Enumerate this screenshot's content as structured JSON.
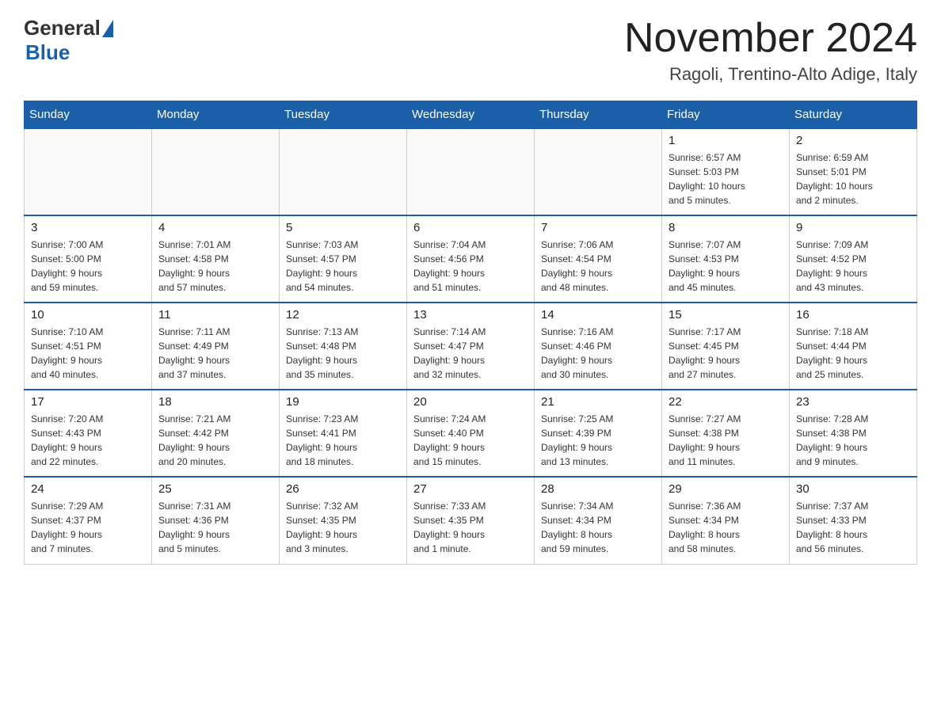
{
  "logo": {
    "general": "General",
    "blue": "Blue"
  },
  "title": "November 2024",
  "location": "Ragoli, Trentino-Alto Adige, Italy",
  "days_of_week": [
    "Sunday",
    "Monday",
    "Tuesday",
    "Wednesday",
    "Thursday",
    "Friday",
    "Saturday"
  ],
  "weeks": [
    [
      {
        "day": "",
        "info": ""
      },
      {
        "day": "",
        "info": ""
      },
      {
        "day": "",
        "info": ""
      },
      {
        "day": "",
        "info": ""
      },
      {
        "day": "",
        "info": ""
      },
      {
        "day": "1",
        "info": "Sunrise: 6:57 AM\nSunset: 5:03 PM\nDaylight: 10 hours\nand 5 minutes."
      },
      {
        "day": "2",
        "info": "Sunrise: 6:59 AM\nSunset: 5:01 PM\nDaylight: 10 hours\nand 2 minutes."
      }
    ],
    [
      {
        "day": "3",
        "info": "Sunrise: 7:00 AM\nSunset: 5:00 PM\nDaylight: 9 hours\nand 59 minutes."
      },
      {
        "day": "4",
        "info": "Sunrise: 7:01 AM\nSunset: 4:58 PM\nDaylight: 9 hours\nand 57 minutes."
      },
      {
        "day": "5",
        "info": "Sunrise: 7:03 AM\nSunset: 4:57 PM\nDaylight: 9 hours\nand 54 minutes."
      },
      {
        "day": "6",
        "info": "Sunrise: 7:04 AM\nSunset: 4:56 PM\nDaylight: 9 hours\nand 51 minutes."
      },
      {
        "day": "7",
        "info": "Sunrise: 7:06 AM\nSunset: 4:54 PM\nDaylight: 9 hours\nand 48 minutes."
      },
      {
        "day": "8",
        "info": "Sunrise: 7:07 AM\nSunset: 4:53 PM\nDaylight: 9 hours\nand 45 minutes."
      },
      {
        "day": "9",
        "info": "Sunrise: 7:09 AM\nSunset: 4:52 PM\nDaylight: 9 hours\nand 43 minutes."
      }
    ],
    [
      {
        "day": "10",
        "info": "Sunrise: 7:10 AM\nSunset: 4:51 PM\nDaylight: 9 hours\nand 40 minutes."
      },
      {
        "day": "11",
        "info": "Sunrise: 7:11 AM\nSunset: 4:49 PM\nDaylight: 9 hours\nand 37 minutes."
      },
      {
        "day": "12",
        "info": "Sunrise: 7:13 AM\nSunset: 4:48 PM\nDaylight: 9 hours\nand 35 minutes."
      },
      {
        "day": "13",
        "info": "Sunrise: 7:14 AM\nSunset: 4:47 PM\nDaylight: 9 hours\nand 32 minutes."
      },
      {
        "day": "14",
        "info": "Sunrise: 7:16 AM\nSunset: 4:46 PM\nDaylight: 9 hours\nand 30 minutes."
      },
      {
        "day": "15",
        "info": "Sunrise: 7:17 AM\nSunset: 4:45 PM\nDaylight: 9 hours\nand 27 minutes."
      },
      {
        "day": "16",
        "info": "Sunrise: 7:18 AM\nSunset: 4:44 PM\nDaylight: 9 hours\nand 25 minutes."
      }
    ],
    [
      {
        "day": "17",
        "info": "Sunrise: 7:20 AM\nSunset: 4:43 PM\nDaylight: 9 hours\nand 22 minutes."
      },
      {
        "day": "18",
        "info": "Sunrise: 7:21 AM\nSunset: 4:42 PM\nDaylight: 9 hours\nand 20 minutes."
      },
      {
        "day": "19",
        "info": "Sunrise: 7:23 AM\nSunset: 4:41 PM\nDaylight: 9 hours\nand 18 minutes."
      },
      {
        "day": "20",
        "info": "Sunrise: 7:24 AM\nSunset: 4:40 PM\nDaylight: 9 hours\nand 15 minutes."
      },
      {
        "day": "21",
        "info": "Sunrise: 7:25 AM\nSunset: 4:39 PM\nDaylight: 9 hours\nand 13 minutes."
      },
      {
        "day": "22",
        "info": "Sunrise: 7:27 AM\nSunset: 4:38 PM\nDaylight: 9 hours\nand 11 minutes."
      },
      {
        "day": "23",
        "info": "Sunrise: 7:28 AM\nSunset: 4:38 PM\nDaylight: 9 hours\nand 9 minutes."
      }
    ],
    [
      {
        "day": "24",
        "info": "Sunrise: 7:29 AM\nSunset: 4:37 PM\nDaylight: 9 hours\nand 7 minutes."
      },
      {
        "day": "25",
        "info": "Sunrise: 7:31 AM\nSunset: 4:36 PM\nDaylight: 9 hours\nand 5 minutes."
      },
      {
        "day": "26",
        "info": "Sunrise: 7:32 AM\nSunset: 4:35 PM\nDaylight: 9 hours\nand 3 minutes."
      },
      {
        "day": "27",
        "info": "Sunrise: 7:33 AM\nSunset: 4:35 PM\nDaylight: 9 hours\nand 1 minute."
      },
      {
        "day": "28",
        "info": "Sunrise: 7:34 AM\nSunset: 4:34 PM\nDaylight: 8 hours\nand 59 minutes."
      },
      {
        "day": "29",
        "info": "Sunrise: 7:36 AM\nSunset: 4:34 PM\nDaylight: 8 hours\nand 58 minutes."
      },
      {
        "day": "30",
        "info": "Sunrise: 7:37 AM\nSunset: 4:33 PM\nDaylight: 8 hours\nand 56 minutes."
      }
    ]
  ]
}
